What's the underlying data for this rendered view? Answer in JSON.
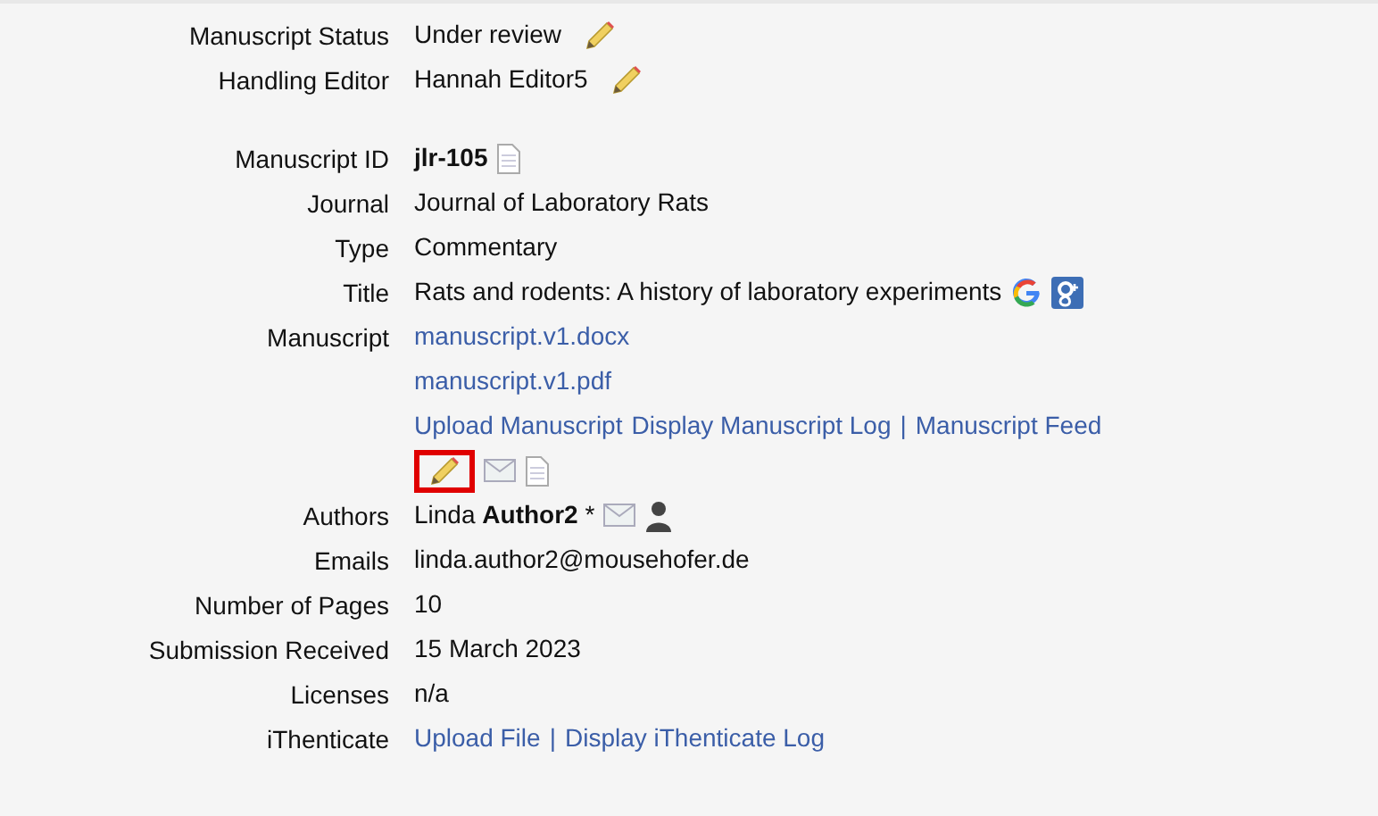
{
  "sections": [
    [
      {
        "label": "Manuscript Status",
        "lines": [
          [
            {
              "kind": "text",
              "text": "Under review"
            },
            {
              "kind": "pencil",
              "highlighted": false
            }
          ]
        ]
      },
      {
        "label": "Handling Editor",
        "lines": [
          [
            {
              "kind": "text",
              "text": "Hannah Editor5"
            },
            {
              "kind": "pencil",
              "highlighted": false
            }
          ]
        ]
      }
    ],
    [
      {
        "label": "Manuscript ID",
        "lines": [
          [
            {
              "kind": "bold",
              "text": "jlr-105"
            },
            {
              "kind": "document"
            }
          ]
        ]
      },
      {
        "label": "Journal",
        "lines": [
          [
            {
              "kind": "text",
              "text": "Journal of Laboratory Rats"
            }
          ]
        ]
      },
      {
        "label": "Type",
        "lines": [
          [
            {
              "kind": "text",
              "text": "Commentary"
            }
          ]
        ]
      },
      {
        "label": "Title",
        "lines": [
          [
            {
              "kind": "text",
              "text": "Rats and rodents: A history of laboratory experiments"
            },
            {
              "kind": "google"
            },
            {
              "kind": "google-plus"
            }
          ]
        ]
      },
      {
        "label": "Manuscript",
        "lines": [
          [
            {
              "kind": "link",
              "text": "manuscript.v1.docx"
            }
          ],
          [
            {
              "kind": "link",
              "text": "manuscript.v1.pdf"
            }
          ],
          [
            {
              "kind": "link",
              "text": "Upload Manuscript"
            },
            {
              "kind": "link",
              "text": "Display Manuscript Log"
            },
            {
              "kind": "separator",
              "text": "|"
            },
            {
              "kind": "link",
              "text": "Manuscript Feed"
            }
          ],
          [
            {
              "kind": "pencil",
              "highlighted": true
            },
            {
              "kind": "mail"
            },
            {
              "kind": "document"
            }
          ]
        ]
      },
      {
        "label": "Authors",
        "lines": [
          [
            {
              "kind": "rich",
              "text": "Linda **Author2** *"
            },
            {
              "kind": "mail"
            },
            {
              "kind": "person"
            }
          ]
        ]
      },
      {
        "label": "Emails",
        "lines": [
          [
            {
              "kind": "text",
              "text": "linda.author2@mousehofer.de"
            }
          ]
        ]
      },
      {
        "label": "Number of Pages",
        "lines": [
          [
            {
              "kind": "text",
              "text": "10"
            }
          ]
        ]
      },
      {
        "label": "Submission Received",
        "lines": [
          [
            {
              "kind": "text",
              "text": "15 March 2023"
            }
          ]
        ]
      },
      {
        "label": "Licenses",
        "lines": [
          [
            {
              "kind": "text",
              "text": "n/a"
            }
          ]
        ]
      },
      {
        "label": "iThenticate",
        "lines": [
          [
            {
              "kind": "link",
              "text": "Upload File"
            },
            {
              "kind": "separator",
              "text": "|"
            },
            {
              "kind": "link",
              "text": "Display iThenticate Log"
            }
          ]
        ]
      }
    ]
  ]
}
